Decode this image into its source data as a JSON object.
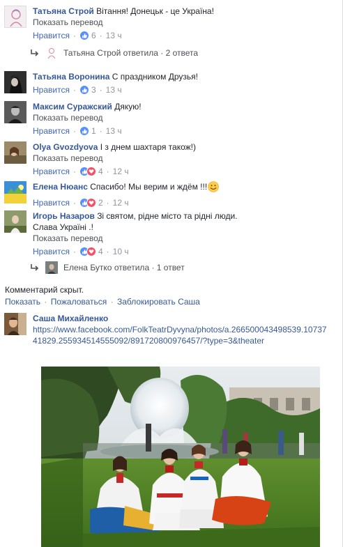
{
  "colors": {
    "link": "#365899",
    "like_blue": "#4267b2",
    "meta": "#90949c",
    "love_red": "#f25268",
    "like_bg": "#5890ff"
  },
  "comments": [
    {
      "name": "Татьяна Строй",
      "text": "Вітання! Донецьк - це Україна!",
      "translate": "Показать перевод",
      "like": "Нравится",
      "count": "6",
      "time": "13 ч",
      "reactions": [
        "like"
      ],
      "reply": {
        "text": "Татьяна Строй ответила · 2 ответа"
      }
    },
    {
      "name": "Татьяна Воронина",
      "text": "С праздником Друзья!",
      "like": "Нравится",
      "count": "3",
      "time": "13 ч",
      "reactions": [
        "like"
      ]
    },
    {
      "name": "Максим Суражский",
      "text": "Дякую!",
      "translate": "Показать перевод",
      "like": "Нравится",
      "count": "1",
      "time": "13 ч",
      "reactions": [
        "like"
      ]
    },
    {
      "name": "Olya Gvozdyova",
      "text": "І з днем шахтаря також!)",
      "translate": "Показать перевод",
      "like": "Нравится",
      "count": "4",
      "time": "12 ч",
      "reactions": [
        "like",
        "love"
      ]
    },
    {
      "name": "Елена Нюанс",
      "text": "Спасибо! Мы верим и ждём !!!",
      "like": "Нравится",
      "count": "2",
      "time": "12 ч",
      "reactions": [
        "like",
        "love"
      ]
    },
    {
      "name": "Игорь Назаров",
      "text": "Зі святом, рідне місто та рідні люди.",
      "text2": "Слава Україні .!",
      "translate": "Показать перевод",
      "like": "Нравится",
      "count": "4",
      "time": "10 ч",
      "reactions": [
        "like",
        "love"
      ],
      "reply": {
        "text": "Елена Бутко ответила · 1 ответ"
      }
    }
  ],
  "hidden_comment": {
    "label": "Комментарий скрыт.",
    "show": "Показать",
    "report": "Пожаловаться",
    "block": "Заблокировать Саша"
  },
  "last_comment": {
    "name": "Саша Михайленко",
    "url_line1": "https://www.facebook.com/FolkTeatrDyvyna/photos/a.266500043498539.10737",
    "url_line2": "41829.255934514555092/891720800976457/?type=3&theater"
  },
  "separator": "·"
}
